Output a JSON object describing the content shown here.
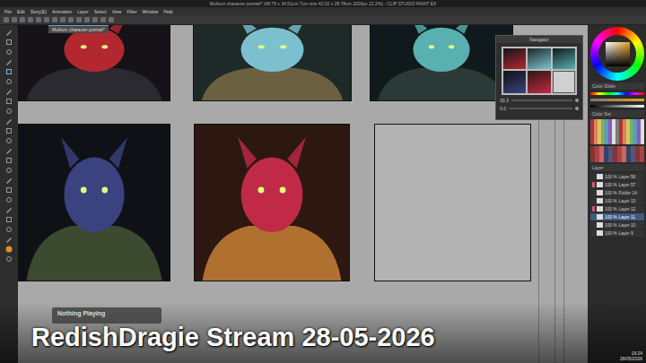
{
  "window": {
    "title": "Multium character portrait* (48.79 x 34.51cm 7cm size 42.00 x 28.78cm 2000px 22.2%) - CLIP STUDIO PAINT EX"
  },
  "menu": [
    "File",
    "Edit",
    "Story(E)",
    "Animation",
    "Layer",
    "Select",
    "View",
    "Filter",
    "Window",
    "Help"
  ],
  "document_tabs": [
    {
      "label": "Multium character portrait*",
      "selected": true
    }
  ],
  "artworks": [
    {
      "kind": "portrait"
    },
    {
      "kind": "portrait"
    },
    {
      "kind": "portrait"
    },
    {
      "kind": "portrait"
    },
    {
      "kind": "portrait"
    },
    {
      "kind": "empty"
    }
  ],
  "navigator": {
    "title": "Navigator",
    "zoom": "33.3",
    "angle": "0.0"
  },
  "panels": {
    "color_slider": "Color Slider",
    "color_set": "Color Set",
    "layer": "Layer"
  },
  "layers": [
    {
      "opacity": "100 %",
      "name": "Layer 58",
      "selected": false
    },
    {
      "opacity": "100 %",
      "name": "Layer 57",
      "selected": false
    },
    {
      "opacity": "100 %",
      "name": "Folder 14",
      "selected": false
    },
    {
      "opacity": "100 %",
      "name": "Layer 13",
      "selected": false
    },
    {
      "opacity": "100 %",
      "name": "Layer 12",
      "selected": false
    },
    {
      "opacity": "100 %",
      "name": "Layer 11",
      "selected": true
    },
    {
      "opacity": "100 %",
      "name": "Layer 10",
      "selected": false
    },
    {
      "opacity": "100 %",
      "name": "Layer 9",
      "selected": false
    }
  ],
  "media": {
    "status": "Nothing Playing"
  },
  "stream_title": "RedishDragie Stream 28-05-2026",
  "clock": {
    "time": "19:24",
    "date": "28/05/2026"
  }
}
